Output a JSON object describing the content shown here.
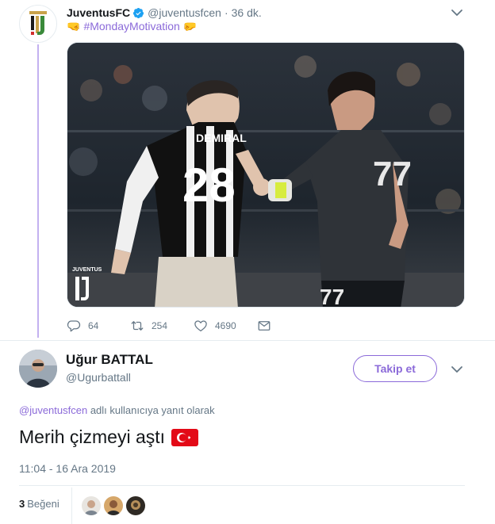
{
  "parent_tweet": {
    "name": "JuventusFC",
    "handle": "@juventusfcen",
    "separator": "·",
    "time": "36 dk.",
    "hashtag": "#MondayMotivation",
    "emoji_left": "🤜",
    "emoji_right": "🤛",
    "media": {
      "player_left_name": "DEMIRAL",
      "player_left_number": "28",
      "player_right_number": "77",
      "watermark": "JUVENTUS"
    },
    "actions": {
      "replies": "64",
      "retweets": "254",
      "likes": "4690"
    },
    "icons": [
      "verified-badge-icon",
      "caret-down-icon",
      "reply-icon",
      "retweet-icon",
      "like-icon",
      "message-icon"
    ]
  },
  "main_tweet": {
    "name": "Uğur BATTAL",
    "handle": "@Ugurbattall",
    "follow_label": "Takip et",
    "reply_to_mention": "@juventusfcen",
    "reply_to_text": "adlı kullanıcıya yanıt olarak",
    "text": "Merih çizmeyi aştı",
    "flag": "turkey-flag-icon",
    "timestamp": "11:04 - 16 Ara 2019",
    "like_count": "3",
    "like_label": "Beğeni"
  },
  "colors": {
    "accent": "#8b6ad9",
    "thread_line": "#c3b1f0",
    "muted": "#657786",
    "text": "#14171a",
    "verified": "#1da1f2"
  }
}
